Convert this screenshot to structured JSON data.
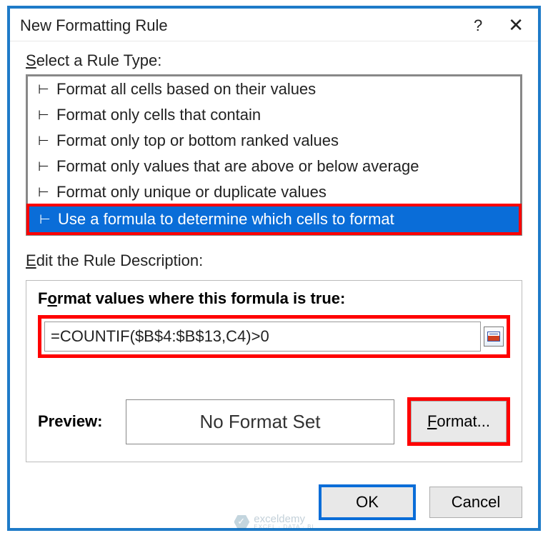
{
  "dialog": {
    "title": "New Formatting Rule",
    "help_aria": "Help",
    "close_aria": "Close"
  },
  "section": {
    "select_label_pre": "S",
    "select_label_rest": "elect a Rule Type:",
    "edit_label_pre": "E",
    "edit_label_rest": "dit the Rule Description:"
  },
  "rules": [
    {
      "label": "Format all cells based on their values",
      "selected": false
    },
    {
      "label": "Format only cells that contain",
      "selected": false
    },
    {
      "label": "Format only top or bottom ranked values",
      "selected": false
    },
    {
      "label": "Format only values that are above or below average",
      "selected": false
    },
    {
      "label": "Format only unique or duplicate values",
      "selected": false
    },
    {
      "label": "Use a formula to determine which cells to format",
      "selected": true
    }
  ],
  "description": {
    "heading_pre": "F",
    "heading_u": "o",
    "heading_rest": "rmat values where this formula is true:",
    "formula": "=COUNTIF($B$4:$B$13,C4)>0"
  },
  "preview": {
    "label": "Preview:",
    "text": "No Format Set",
    "format_btn_pre": "F",
    "format_btn_rest": "ormat..."
  },
  "buttons": {
    "ok": "OK",
    "cancel": "Cancel"
  },
  "watermark": {
    "name": "exceldemy",
    "sub": "EXCEL · DATA · BI"
  }
}
